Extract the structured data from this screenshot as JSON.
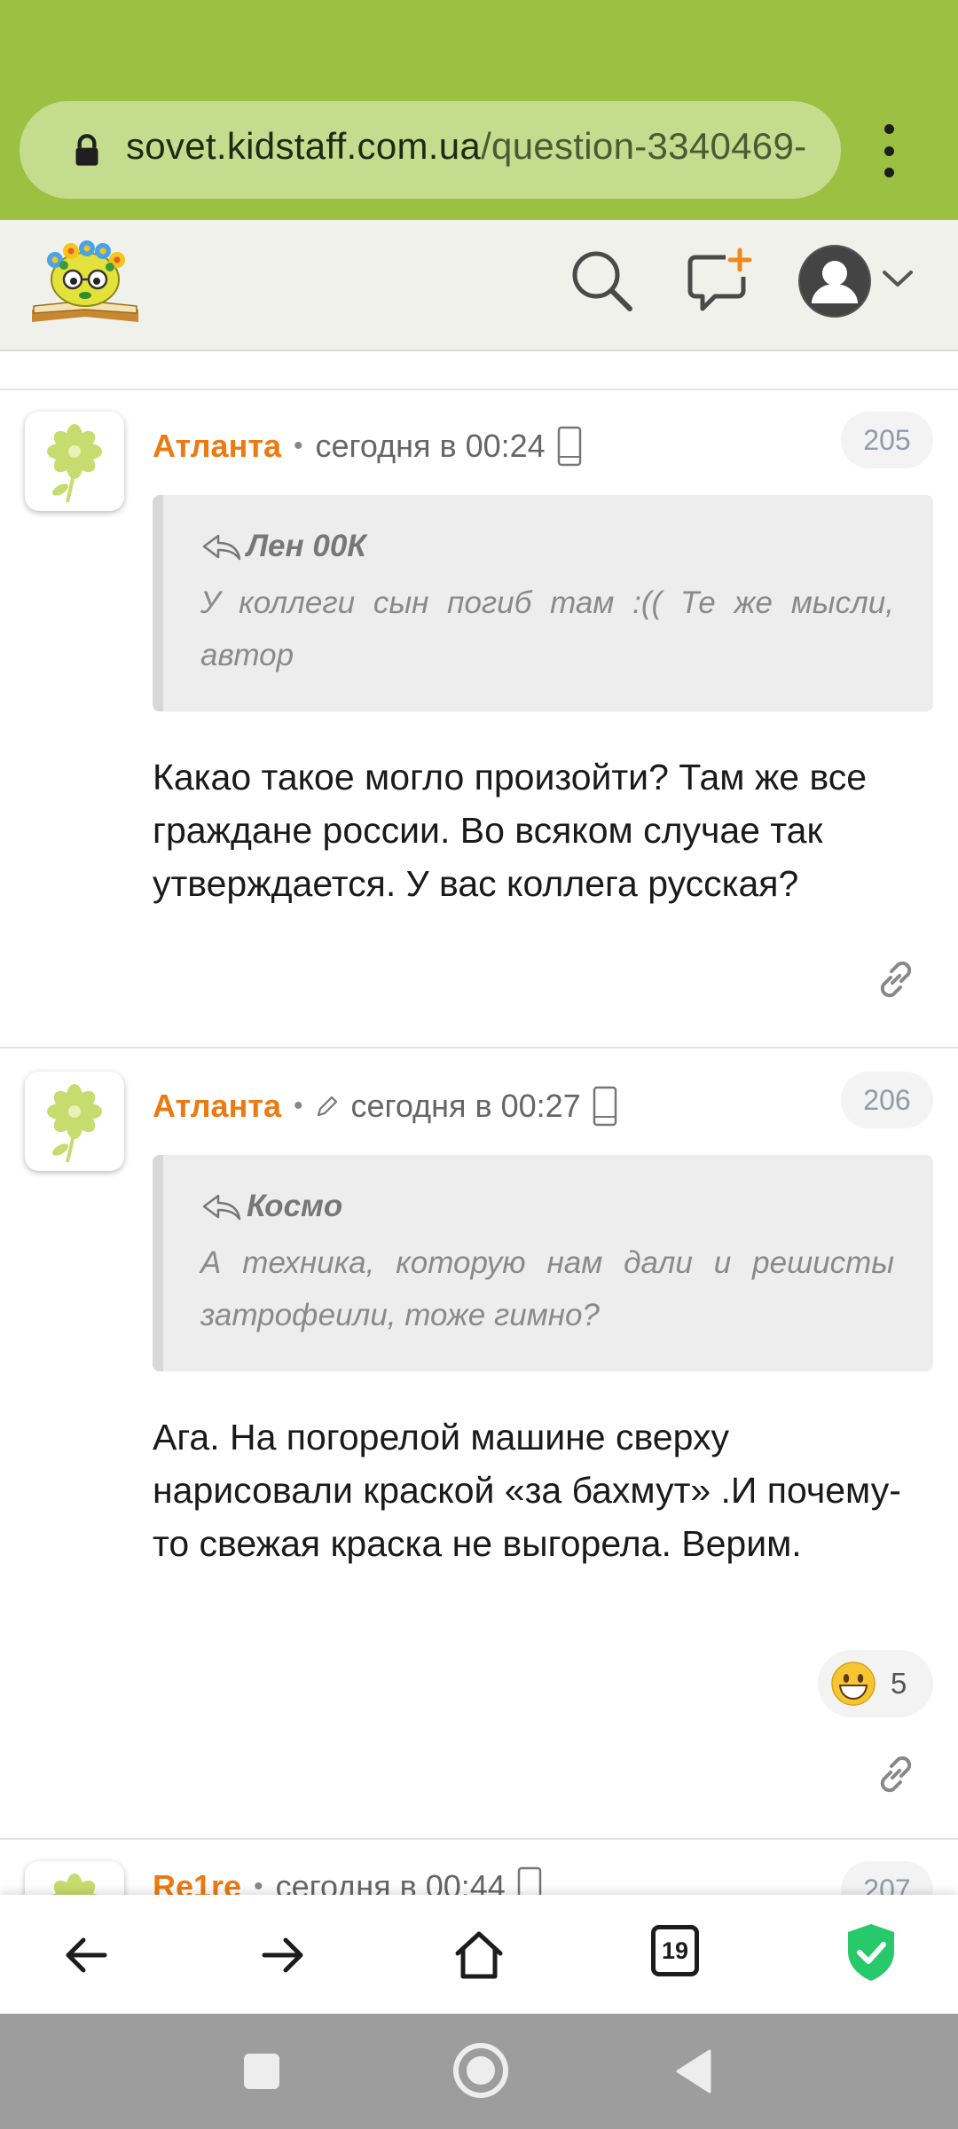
{
  "browser": {
    "url_domain": "sovet.kidstaff.com.ua",
    "url_path": "/question-3340469-",
    "tab_count": "19",
    "accent_color": "#9cc142"
  },
  "site_header": {
    "icons": [
      "logo",
      "search-icon",
      "new-question-icon",
      "user-avatar",
      "chevron-down-icon"
    ]
  },
  "comments": [
    {
      "author": "Атланта",
      "dot": "•",
      "time": "сегодня в 00:24",
      "number": "205",
      "edited": false,
      "quote_author": "Лен 00К",
      "quote_text": "У коллеги сын погиб там :(( Те же мысли, автор",
      "body": "Какао такое могло произойти? Там же все граждане россии. Во всяком случае так утверждается. У вас коллега русская?"
    },
    {
      "author": "Атланта",
      "dot": "•",
      "time": "сегодня в 00:27",
      "number": "206",
      "edited": true,
      "quote_author": "Космо",
      "quote_text": "А техника, которую нам дали и решисты затрофеили, тоже гимно?",
      "body": "Ага. На погорелой машине сверху нарисовали краской «за бахмут» .И почему-то свежая краска не выгорела. Верим.",
      "reaction_emoji": "grinning-face",
      "reaction_count": "5"
    },
    {
      "author": "Re1re",
      "dot": "•",
      "time": "сегодня в 00:44",
      "number": "207"
    }
  ]
}
